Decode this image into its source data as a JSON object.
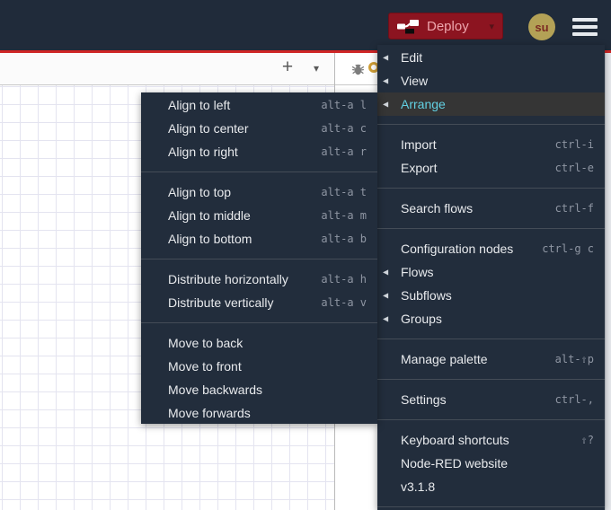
{
  "header": {
    "deploy_label": "Deploy",
    "deploy_caret_icon": "▾",
    "avatar_initials": "su",
    "hamburger_icon": "menu"
  },
  "workspace": {
    "add_flow_icon": "+",
    "flow_list_caret_icon": "▾",
    "debug_icon": "bug"
  },
  "colors": {
    "header_bg": "#202b3a",
    "menu_bg": "#222d3c",
    "menu_highlight_bg": "#353535",
    "menu_active_label": "#62d0e2",
    "accent_red_line": "#cf2626",
    "deploy_button_bg": "#8c1420",
    "deploy_button_text": "#eda6ad",
    "avatar_bg": "#b3a156",
    "grid_line": "#e4e4f0"
  },
  "main_menu": {
    "items": [
      {
        "label": "Edit",
        "submenu": true
      },
      {
        "label": "View",
        "submenu": true
      },
      {
        "label": "Arrange",
        "submenu": true,
        "active": true
      },
      {
        "divider": true
      },
      {
        "label": "Import",
        "shortcut": "ctrl-i"
      },
      {
        "label": "Export",
        "shortcut": "ctrl-e"
      },
      {
        "divider": true
      },
      {
        "label": "Search flows",
        "shortcut": "ctrl-f"
      },
      {
        "divider": true
      },
      {
        "label": "Configuration nodes",
        "shortcut": "ctrl-g c"
      },
      {
        "label": "Flows",
        "submenu": true
      },
      {
        "label": "Subflows",
        "submenu": true
      },
      {
        "label": "Groups",
        "submenu": true
      },
      {
        "divider": true
      },
      {
        "label": "Manage palette",
        "shortcut": "alt-⇧p"
      },
      {
        "divider": true
      },
      {
        "label": "Settings",
        "shortcut": "ctrl-,"
      },
      {
        "divider": true
      },
      {
        "label": "Keyboard shortcuts",
        "shortcut": "⇧?"
      },
      {
        "label": "Node-RED website"
      },
      {
        "label": "v3.1.8"
      },
      {
        "divider": true
      }
    ]
  },
  "arrange_submenu": {
    "items": [
      {
        "label": "Align to left",
        "shortcut": "alt-a l"
      },
      {
        "label": "Align to center",
        "shortcut": "alt-a c"
      },
      {
        "label": "Align to right",
        "shortcut": "alt-a r"
      },
      {
        "divider": true
      },
      {
        "label": "Align to top",
        "shortcut": "alt-a t"
      },
      {
        "label": "Align to middle",
        "shortcut": "alt-a m"
      },
      {
        "label": "Align to bottom",
        "shortcut": "alt-a b"
      },
      {
        "divider": true
      },
      {
        "label": "Distribute horizontally",
        "shortcut": "alt-a h"
      },
      {
        "label": "Distribute vertically",
        "shortcut": "alt-a v"
      },
      {
        "divider": true
      },
      {
        "label": "Move to back"
      },
      {
        "label": "Move to front"
      },
      {
        "label": "Move backwards"
      },
      {
        "label": "Move forwards"
      }
    ]
  }
}
